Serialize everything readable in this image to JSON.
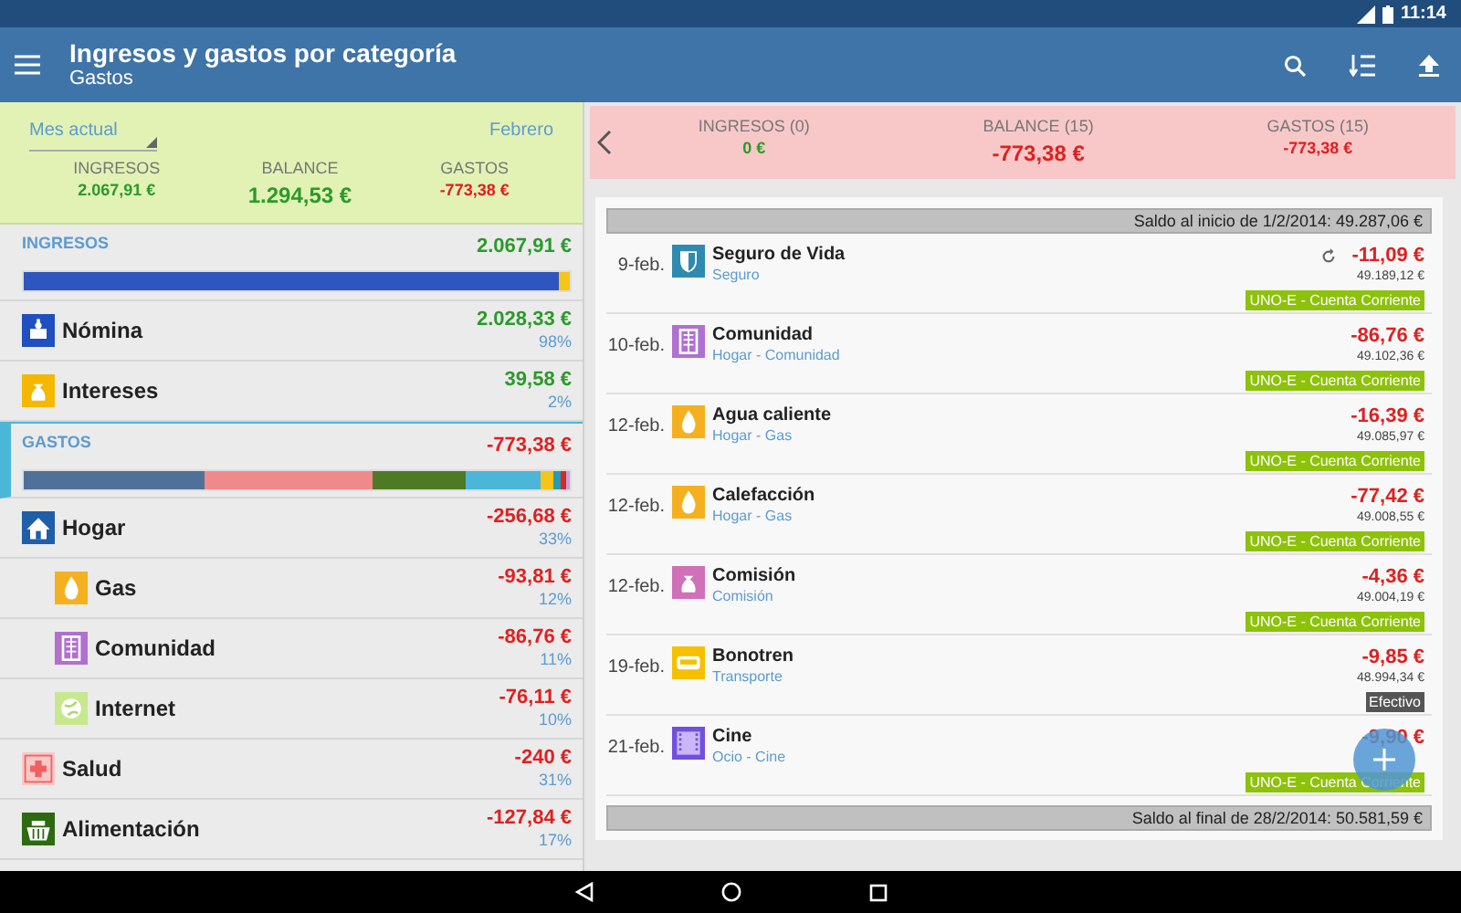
{
  "status_bar": {
    "time": "11:14"
  },
  "app_bar": {
    "title": "Ingresos y gastos por categoría",
    "subtitle": "Gastos"
  },
  "summary": {
    "period": "Mes actual",
    "month": "Febrero",
    "income_label": "INGRESOS",
    "income": "2.067,91 €",
    "balance_label": "BALANCE",
    "balance": "1.294,53 €",
    "expense_label": "GASTOS",
    "expense": "-773,38 €"
  },
  "sections": [
    {
      "kind": "income",
      "title": "INGRESOS",
      "total": "2.067,91 €",
      "selected": false,
      "categories": [
        {
          "kind": "salary",
          "name": "Nómina",
          "amount": "2.028,33 €",
          "percent": "98%"
        },
        {
          "kind": "money",
          "name": "Intereses",
          "amount": "39,58 €",
          "percent": "2%"
        }
      ]
    },
    {
      "kind": "expense",
      "title": "GASTOS",
      "total": "-773,38 €",
      "selected": true,
      "categories": [
        {
          "kind": "house",
          "name": "Hogar",
          "amount": "-256,68 €",
          "percent": "33%",
          "children": [
            {
              "kind": "flame",
              "name": "Gas",
              "amount": "-93,81 €",
              "percent": "12%"
            },
            {
              "kind": "building",
              "name": "Comunidad",
              "amount": "-86,76 €",
              "percent": "11%"
            },
            {
              "kind": "globe",
              "name": "Internet",
              "amount": "-76,11 €",
              "percent": "10%"
            }
          ]
        },
        {
          "kind": "health",
          "name": "Salud",
          "amount": "-240 €",
          "percent": "31%"
        },
        {
          "kind": "basket",
          "name": "Alimentación",
          "amount": "-127,84 €",
          "percent": "17%"
        }
      ]
    }
  ],
  "detail": {
    "income_label": "INGRESOS (0)",
    "income": "0 €",
    "balance_label": "BALANCE (15)",
    "balance": "-773,38 €",
    "expense_label": "GASTOS (15)",
    "expense": "-773,38 €",
    "opening": "Saldo al inicio de 1/2/2014: 49.287,06 €",
    "transactions": [
      {
        "date": "9-feb.",
        "kind": "shield",
        "name": "Seguro de Vida",
        "category": "Seguro",
        "recurring": true,
        "amount": "-11,09 €",
        "balance": "49.189,12 €",
        "account": {
          "kind": "bank",
          "name": "UNO-E - Cuenta Corriente"
        }
      },
      {
        "date": "10-feb.",
        "kind": "building",
        "name": "Comunidad",
        "category": "Hogar - Comunidad",
        "recurring": false,
        "amount": "-86,76 €",
        "balance": "49.102,36 €",
        "account": {
          "kind": "bank",
          "name": "UNO-E - Cuenta Corriente"
        }
      },
      {
        "date": "12-feb.",
        "kind": "flame",
        "name": "Agua caliente",
        "category": "Hogar - Gas",
        "recurring": false,
        "amount": "-16,39 €",
        "balance": "49.085,97 €",
        "account": {
          "kind": "bank",
          "name": "UNO-E - Cuenta Corriente"
        }
      },
      {
        "date": "12-feb.",
        "kind": "flame",
        "name": "Calefacción",
        "category": "Hogar - Gas",
        "recurring": false,
        "amount": "-77,42 €",
        "balance": "49.008,55 €",
        "account": {
          "kind": "bank",
          "name": "UNO-E - Cuenta Corriente"
        }
      },
      {
        "date": "12-feb.",
        "kind": "money2",
        "name": "Comisión",
        "category": "Comisión",
        "recurring": false,
        "amount": "-4,36 €",
        "balance": "49.004,19 €",
        "account": {
          "kind": "bank",
          "name": "UNO-E - Cuenta Corriente"
        }
      },
      {
        "date": "19-feb.",
        "kind": "bus",
        "name": "Bonotren",
        "category": "Transporte",
        "recurring": false,
        "amount": "-9,85 €",
        "balance": "48.994,34 €",
        "account": {
          "kind": "cash",
          "name": "Efectivo"
        }
      },
      {
        "date": "21-feb.",
        "kind": "film",
        "name": "Cine",
        "category": "Ocio - Cine",
        "recurring": false,
        "amount": "-9,90 €",
        "account": {
          "kind": "bank",
          "name": "UNO-E - Cuenta Corriente"
        }
      }
    ],
    "closing": "Saldo al final de 28/2/2014: 50.581,59 €"
  }
}
